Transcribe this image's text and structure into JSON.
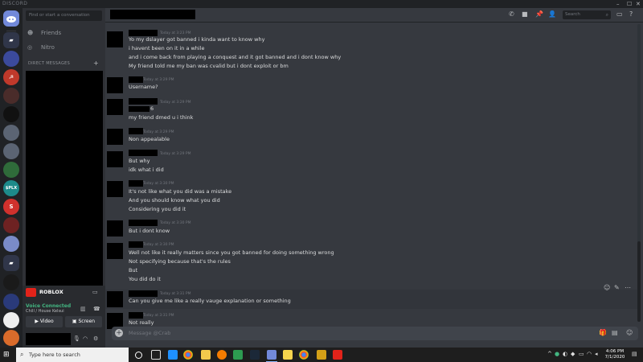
{
  "titlebar": {
    "brand": "DISCORD",
    "minimize": "–",
    "maximize": "☐",
    "close": "✕"
  },
  "sidebar": {
    "search_placeholder": "Find or start a conversation",
    "friends_label": "Friends",
    "nitro_label": "Nitro",
    "dm_header": "DIRECT MESSAGES",
    "dm_add": "+"
  },
  "guilds": [
    {
      "label": "",
      "color": "#7289da"
    },
    {
      "label": "",
      "color": "#3b4a9c"
    },
    {
      "label": "",
      "color": "#1a7f4f"
    },
    {
      "label": "☭",
      "color": "#c0392b"
    },
    {
      "label": "",
      "color": "#4a2c2a"
    },
    {
      "label": "",
      "color": "#111111"
    },
    {
      "label": "",
      "color": "#5b6473"
    },
    {
      "label": "",
      "color": "#2f6b3a"
    },
    {
      "label": "$PLX",
      "color": "#1d8a8a"
    },
    {
      "label": "S",
      "color": "#d0312d"
    },
    {
      "label": "",
      "color": "#6e2222"
    },
    {
      "label": "",
      "color": "#7a8bc8"
    },
    {
      "label": "",
      "color": "#4a5aa8"
    },
    {
      "label": "",
      "color": "#1a1a1a"
    },
    {
      "label": "",
      "color": "#2a3a7a"
    },
    {
      "label": "",
      "color": "#eeeeee"
    },
    {
      "label": "",
      "color": "#d96b2b"
    }
  ],
  "voice": {
    "game_name": "ROBLOX",
    "status": "Voice Connected",
    "channel": "Chill / House Kelsui",
    "video_label": "Video",
    "screen_label": "Screen"
  },
  "header": {
    "search_placeholder": "Search"
  },
  "messages": [
    {
      "time": "Today at 3:23 PM",
      "lines": [
        "Yo my dslayer got banned i kinda want to know why",
        "i havent been on it in a while",
        "and i come back from playing a conquest and it got banned and i dont know why",
        "My friend told me my ban was cvalid but i dont exploit or bm"
      ]
    },
    {
      "time": "Today at 3:29 PM",
      "lines": [
        "Username?"
      ]
    },
    {
      "time": "Today at 3:29 PM",
      "lines": [
        "6",
        "my friend dmed u i think"
      ]
    },
    {
      "time": "Today at 3:29 PM",
      "lines": [
        "Non appealable"
      ]
    },
    {
      "time": "Today at 3:29 PM",
      "lines": [
        "But why",
        "idk what i did"
      ]
    },
    {
      "time": "Today at 3:30 PM",
      "lines": [
        "It's not like what you did was a mistake",
        "And you should know what you did",
        "Considering you did it"
      ]
    },
    {
      "time": "Today at 3:30 PM",
      "lines": [
        "But i dont know"
      ]
    },
    {
      "time": "Today at 3:30 PM",
      "lines": [
        "Well not like it really matters since you got banned for doing something wrong",
        "Not specifying because that's the rules",
        "But",
        "You did do it"
      ]
    },
    {
      "time": "Today at 3:31 PM",
      "lines": [
        "Can you give me like a really vauge explanation or something"
      ]
    },
    {
      "time": "Today at 3:31 PM",
      "lines": [
        "Not really"
      ]
    }
  ],
  "composer": {
    "placeholder": "Message @Crab"
  },
  "taskbar": {
    "search_placeholder": "Type here to search",
    "time": "4:06 PM",
    "date": "7/1/2020"
  }
}
